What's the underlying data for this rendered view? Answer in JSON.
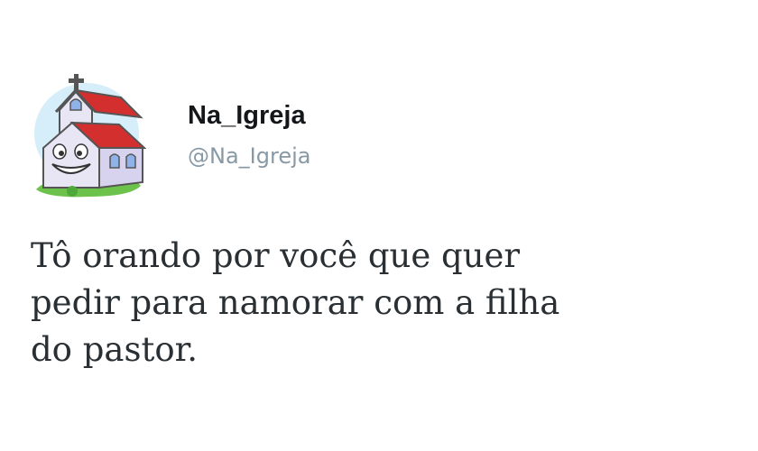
{
  "tweet": {
    "display_name": "Na_Igreja",
    "handle": "@Na_Igreja",
    "text_lines": [
      "Tô orando por você que quer",
      "pedir para namorar com a filha",
      "do pastor."
    ]
  },
  "avatar": {
    "icon": "church-cartoon-icon",
    "colors": {
      "roof": "#d32f2f",
      "walls": "#e8e6f5",
      "grass": "#6cc24a",
      "sky": "#bfe3f5"
    }
  }
}
